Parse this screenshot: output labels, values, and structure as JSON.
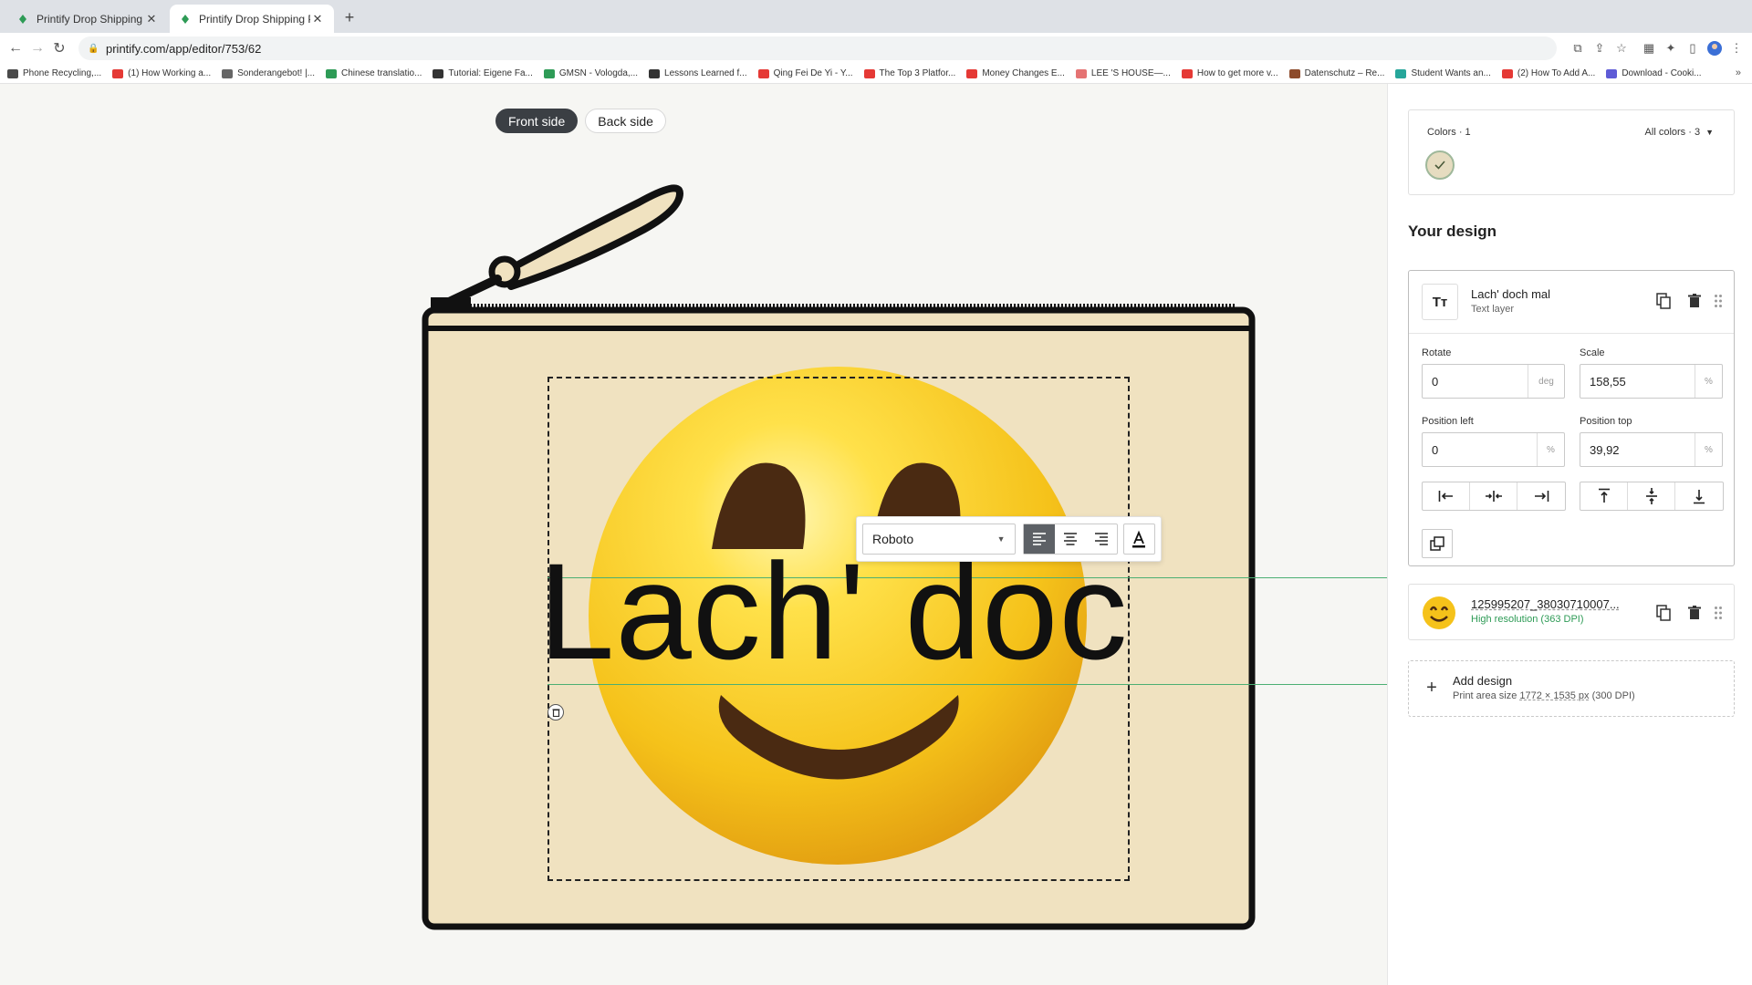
{
  "browser": {
    "tabs": [
      {
        "title": "Printify Drop Shipping & Printi",
        "active": false
      },
      {
        "title": "Printify Drop Shipping Print on",
        "active": true
      }
    ],
    "url": "printify.com/app/editor/753/62",
    "bookmarks": [
      {
        "label": "Phone Recycling,...",
        "color": "#4a4a4a"
      },
      {
        "label": "(1) How Working a...",
        "color": "#e53935"
      },
      {
        "label": "Sonderangebot! |...",
        "color": "#666666"
      },
      {
        "label": "Chinese translatio...",
        "color": "#2e9b56"
      },
      {
        "label": "Tutorial: Eigene Fa...",
        "color": "#333333"
      },
      {
        "label": "GMSN - Vologda,...",
        "color": "#2e9b56"
      },
      {
        "label": "Lessons Learned f...",
        "color": "#333333"
      },
      {
        "label": "Qing Fei De Yi - Y...",
        "color": "#e53935"
      },
      {
        "label": "The Top 3 Platfor...",
        "color": "#e53935"
      },
      {
        "label": "Money Changes E...",
        "color": "#e53935"
      },
      {
        "label": "LEE 'S HOUSE—...",
        "color": "#e57373"
      },
      {
        "label": "How to get more v...",
        "color": "#e53935"
      },
      {
        "label": "Datenschutz – Re...",
        "color": "#8d4a2a"
      },
      {
        "label": "Student Wants an...",
        "color": "#26a69a"
      },
      {
        "label": "(2) How To Add A...",
        "color": "#e53935"
      },
      {
        "label": "Download - Cooki...",
        "color": "#5e5bd6"
      }
    ],
    "more": "»"
  },
  "editor": {
    "sides": {
      "front": "Front side",
      "back": "Back side",
      "active": "front"
    },
    "layer_text": "Lach' doc",
    "font_name": "Roboto",
    "product_color": "#f0e2c0"
  },
  "panel": {
    "colors": {
      "label": "Colors · 1",
      "all_label": "All colors · 3",
      "selected_color": "#e6dcc0"
    },
    "your_design_title": "Your design",
    "text_layer": {
      "thumb": "Tт",
      "name": "Lach' doch mal",
      "type": "Text layer",
      "rotate": {
        "label": "Rotate",
        "value": "0",
        "unit": "deg"
      },
      "scale": {
        "label": "Scale",
        "value": "158,55",
        "unit": "%"
      },
      "position_left": {
        "label": "Position left",
        "value": "0",
        "unit": "%"
      },
      "position_top": {
        "label": "Position top",
        "value": "39,92",
        "unit": "%"
      }
    },
    "image_layer": {
      "name": "125995207_38030710007...",
      "resolution": "High resolution (363 DPI)",
      "thumb": "😊"
    },
    "add_design": {
      "title": "Add design",
      "subtitle_prefix": "Print area size ",
      "subtitle_size": "1772 × 1535 px",
      "subtitle_suffix": " (300 DPI)"
    }
  }
}
